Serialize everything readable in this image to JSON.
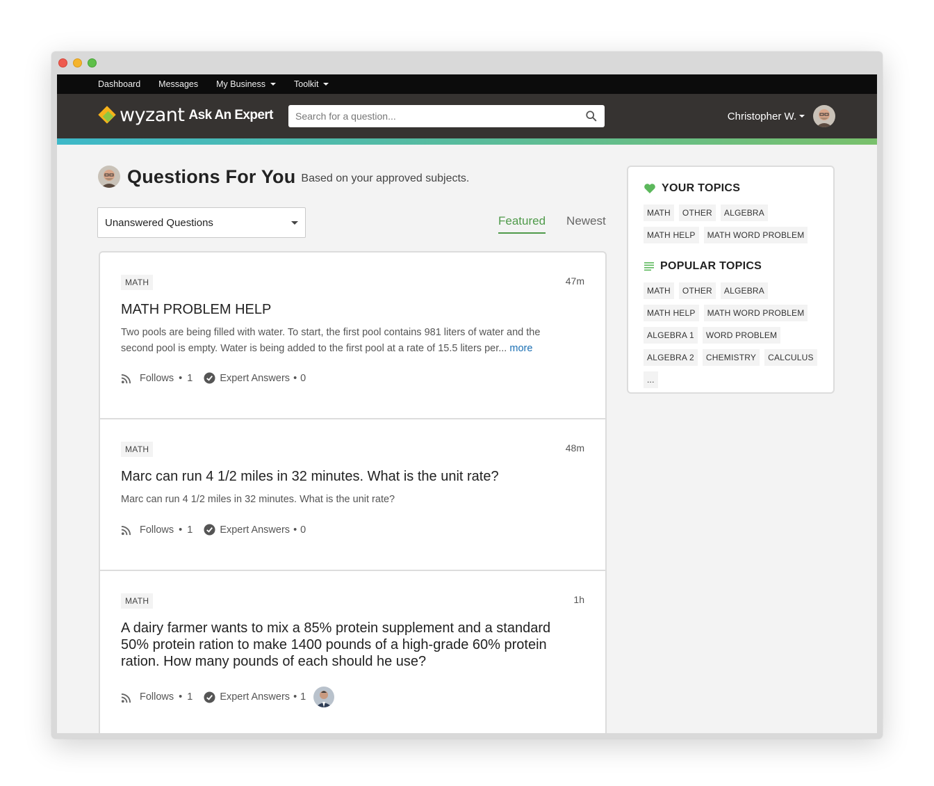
{
  "topnav": {
    "items": [
      "Dashboard",
      "Messages",
      "My Business",
      "Toolkit"
    ]
  },
  "header": {
    "logo_text": "wyzant",
    "logo_suffix": "Ask An Expert",
    "search_placeholder": "Search for a question...",
    "user_name": "Christopher W."
  },
  "colors": {
    "accent_green": "#4f9a4a",
    "link_blue": "#1a6fb3",
    "header_bg": "#363331",
    "logo_orange": "#f6b21a"
  },
  "page": {
    "title": "Questions For You",
    "subtitle": "Based on your approved subjects.",
    "filter_value": "Unanswered Questions",
    "tabs": [
      {
        "label": "Featured",
        "active": true
      },
      {
        "label": "Newest",
        "active": false
      }
    ]
  },
  "questions": [
    {
      "tag": "MATH",
      "time": "47m",
      "title": "MATH PROBLEM HELP",
      "body": "Two pools are being filled with water. To start, the first pool contains 981 liters of water and the second pool is empty. Water is being added to the first pool at a rate of 15.5 liters per...",
      "more": "more",
      "follows_label": "Follows",
      "follows_count": "1",
      "answers_label": "Expert Answers",
      "answers_count": "0"
    },
    {
      "tag": "MATH",
      "time": "48m",
      "title": "Marc can run 4 1/2 miles in 32 minutes. What is the unit rate?",
      "body": "Marc can run 4 1/2 miles in 32 minutes. What is the unit rate?",
      "follows_label": "Follows",
      "follows_count": "1",
      "answers_label": "Expert Answers",
      "answers_count": "0"
    },
    {
      "tag": "MATH",
      "time": "1h",
      "title": "A dairy farmer wants to mix a 85% protein supplement and a standard 50% protein ration to make 1400 pounds of a high-grade 60% protein ration. How many pounds of each should he use?",
      "follows_label": "Follows",
      "follows_count": "1",
      "answers_label": "Expert Answers",
      "answers_count": "1"
    }
  ],
  "sidebar": {
    "your_topics_title": "YOUR TOPICS",
    "your_topics": [
      "MATH",
      "OTHER",
      "ALGEBRA",
      "MATH HELP",
      "MATH WORD PROBLEM"
    ],
    "popular_topics_title": "POPULAR TOPICS",
    "popular_topics": [
      "MATH",
      "OTHER",
      "ALGEBRA",
      "MATH HELP",
      "MATH WORD PROBLEM",
      "ALGEBRA 1",
      "WORD PROBLEM",
      "ALGEBRA 2",
      "CHEMISTRY",
      "CALCULUS",
      "..."
    ]
  }
}
